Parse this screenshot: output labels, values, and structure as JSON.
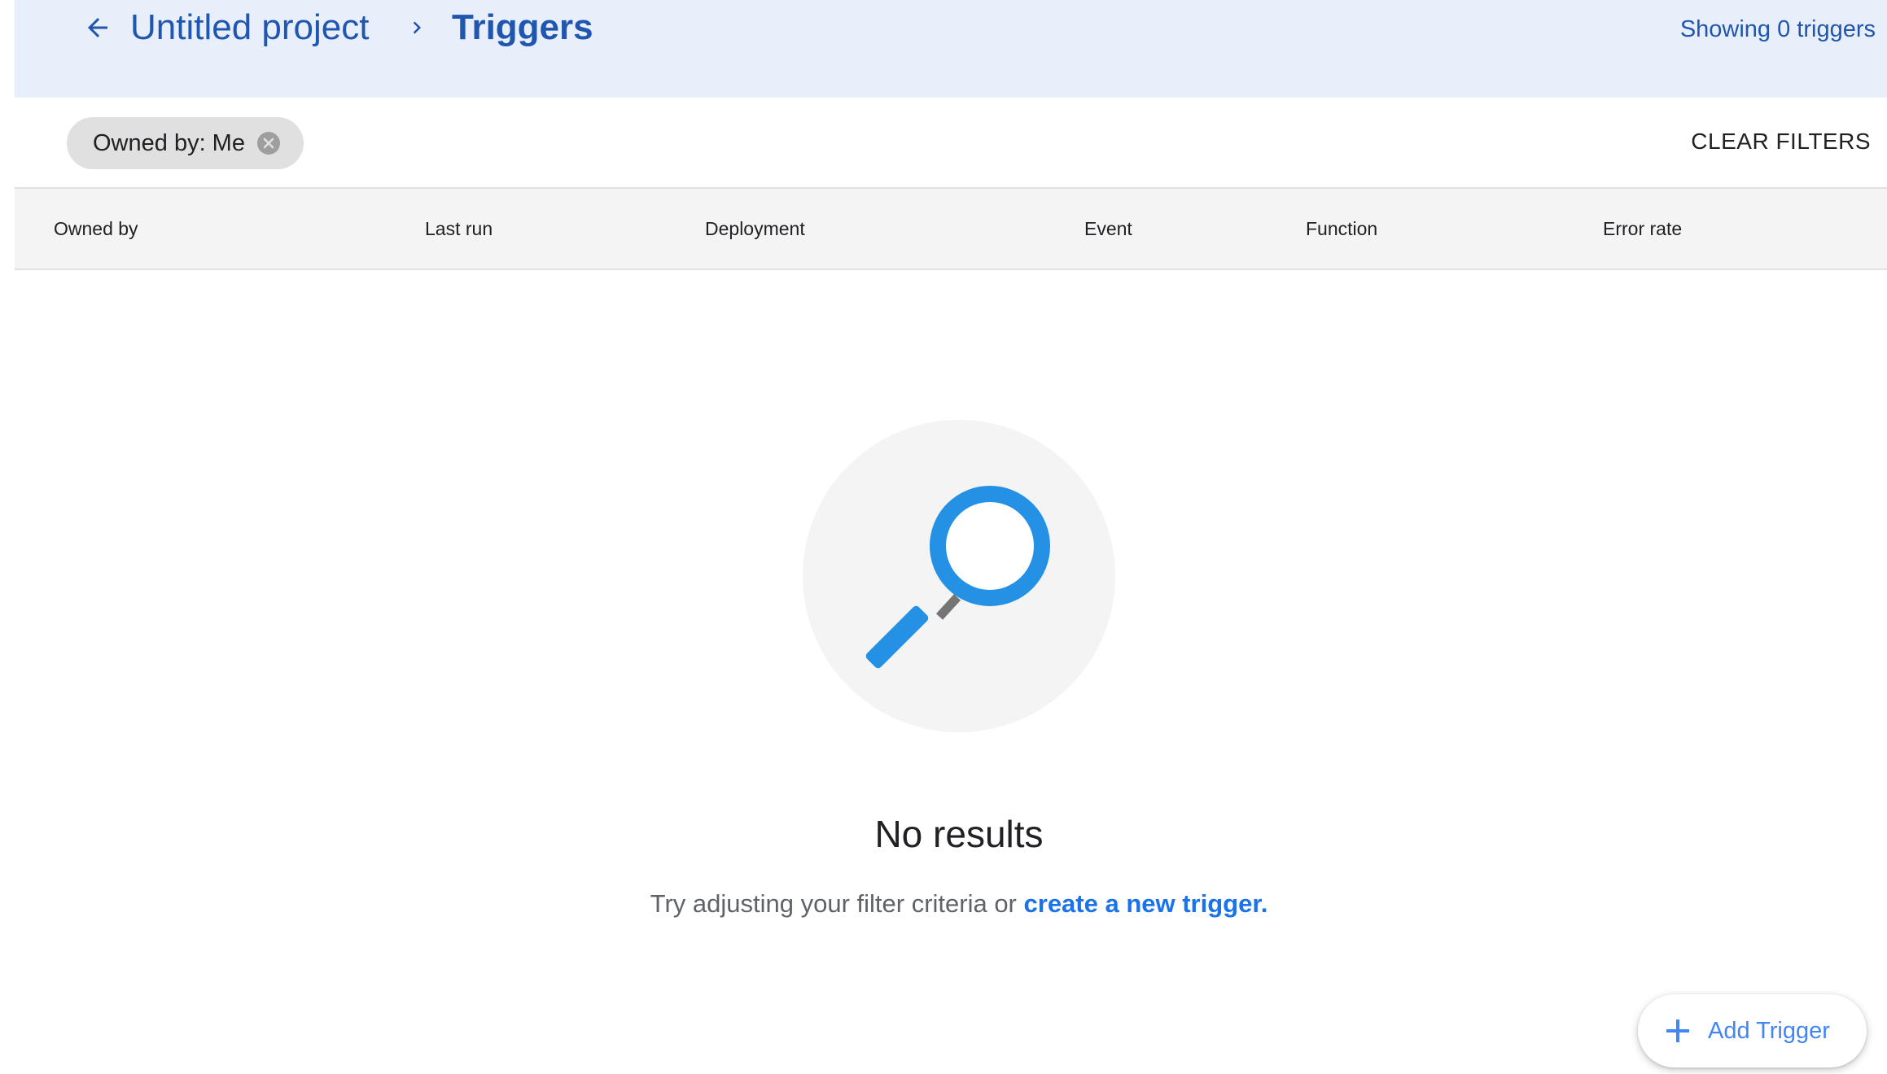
{
  "header": {
    "back_icon": "arrow-left-icon",
    "breadcrumb": [
      {
        "label": "Untitled project"
      },
      {
        "label": "Triggers"
      }
    ],
    "separator_icon": "chevron-right-icon",
    "showing_text": "Showing 0 triggers"
  },
  "filters": {
    "chips": [
      {
        "label": "Owned by: Me",
        "remove_icon": "cancel-circle-icon"
      }
    ],
    "clear_label": "CLEAR FILTERS"
  },
  "table": {
    "columns": [
      "Owned by",
      "Last run",
      "Deployment",
      "Event",
      "Function",
      "Error rate"
    ],
    "rows": []
  },
  "empty_state": {
    "illustration_icon": "magnifying-glass-icon",
    "title": "No results",
    "message": "Try adjusting your filter criteria or",
    "link_text": "create a new trigger."
  },
  "fab": {
    "icon": "plus-icon",
    "label": "Add Trigger"
  },
  "colors": {
    "header_bg": "#e8effb",
    "header_text": "#1f56b0",
    "link": "#1a73e8",
    "fab_text": "#4285f4",
    "illustration_blue": "#2491e5"
  }
}
